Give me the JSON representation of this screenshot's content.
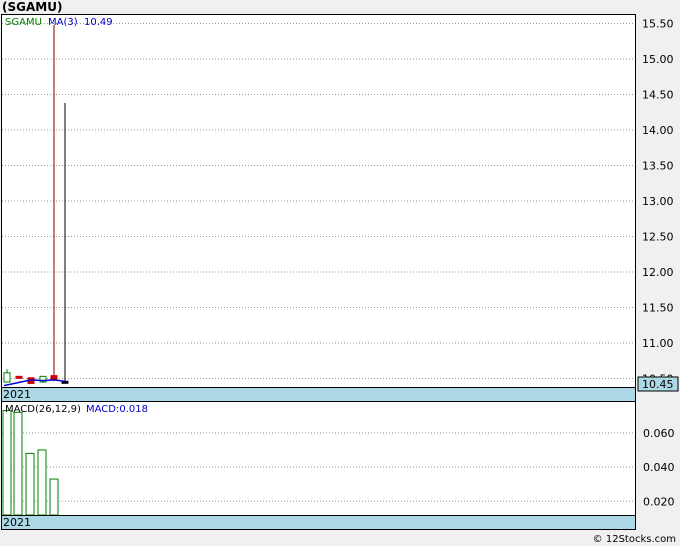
{
  "header": {
    "title": "(SGAMU)"
  },
  "footer": {
    "credit": "© 12Stocks.com"
  },
  "price_panel": {
    "legend_symbol": "SGAMU",
    "legend_ma": "MA(3)",
    "legend_ma_value": "10.49",
    "last_price_label": "10.45",
    "year_label": "2021",
    "colors": {
      "up_candle": "#008000",
      "down_candle": "#cc0000",
      "ma_line": "#0000cc",
      "wick": "#800000",
      "axis_box": "#add8e6"
    }
  },
  "macd_panel": {
    "legend_params": "MACD(26,12,9)",
    "legend_value": "MACD:0.018",
    "year_label": "2021"
  },
  "chart_data": [
    {
      "type": "candlestick",
      "title": "(SGAMU)",
      "ylim": [
        10.38,
        15.62
      ],
      "y_ticks": [
        "10.50",
        "11.00",
        "11.50",
        "12.00",
        "12.50",
        "13.00",
        "13.50",
        "14.00",
        "14.50",
        "15.00",
        "15.50"
      ],
      "x_tick_labels": [
        "2021"
      ],
      "grid": true,
      "candles": [
        {
          "open": 10.45,
          "high": 10.63,
          "low": 10.45,
          "close": 10.58,
          "color": "green"
        },
        {
          "open": 10.53,
          "high": 10.53,
          "low": 10.51,
          "close": 10.51,
          "color": "red"
        },
        {
          "open": 10.51,
          "high": 10.51,
          "low": 10.43,
          "close": 10.43,
          "color": "red"
        },
        {
          "open": 10.45,
          "high": 10.53,
          "low": 10.44,
          "close": 10.53,
          "color": "green"
        },
        {
          "open": 10.54,
          "high": 15.48,
          "low": 10.46,
          "close": 10.48,
          "color": "red"
        },
        {
          "open": 10.46,
          "high": 14.38,
          "low": 10.45,
          "close": 10.45,
          "color": "black"
        }
      ],
      "ma_series": {
        "name": "MA(3)",
        "values": [
          null,
          null,
          10.48,
          10.47,
          10.48,
          10.46
        ]
      },
      "last_value": 10.45
    },
    {
      "type": "bar",
      "title": "MACD(26,12,9)",
      "ylim": [
        0.012,
        0.078
      ],
      "y_ticks": [
        "0.020",
        "0.040",
        "0.060"
      ],
      "values": [
        0.073,
        0.072,
        0.048,
        0.05,
        0.033
      ],
      "last_value": 0.018
    }
  ]
}
